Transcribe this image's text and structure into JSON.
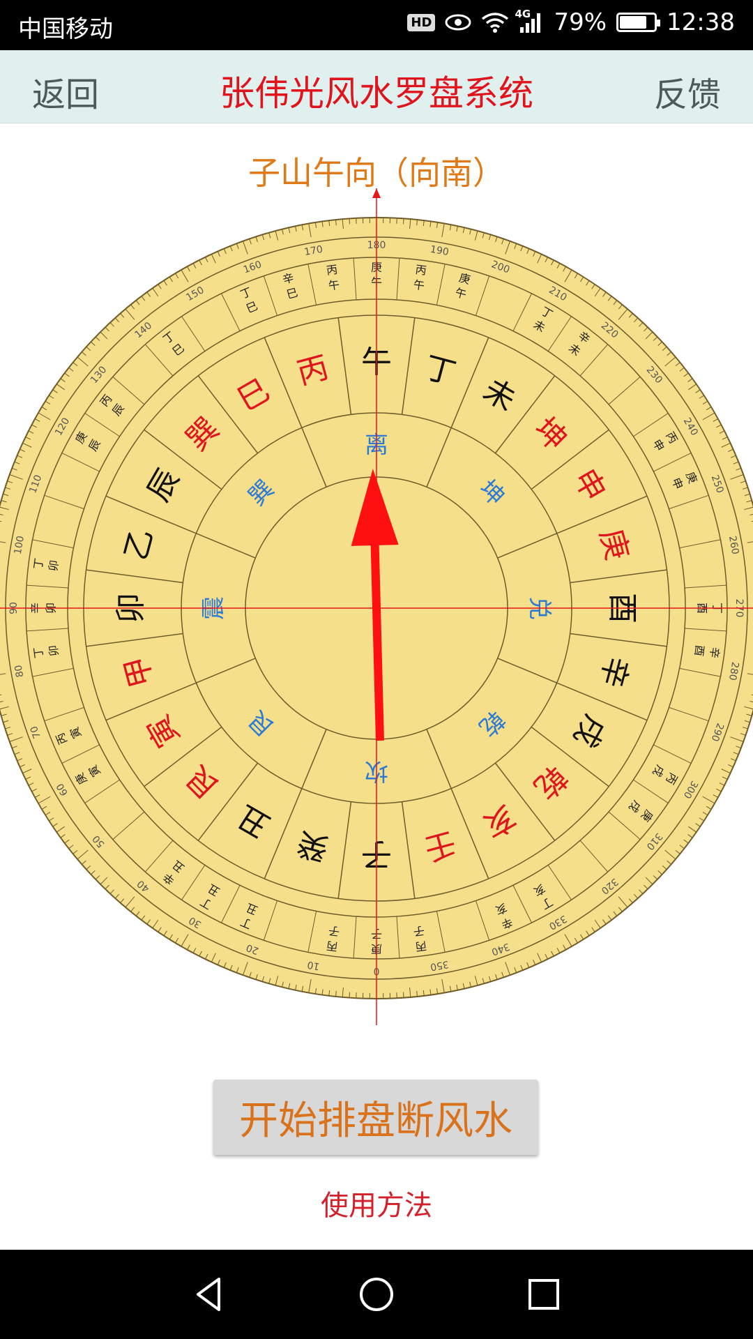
{
  "status_bar": {
    "carrier": "中国移动",
    "hd": "HD",
    "network": "4G",
    "battery": "79%",
    "battery_level": 0.79,
    "time": "12:38"
  },
  "header": {
    "back_label": "返回",
    "title": "张伟光风水罗盘系统",
    "feedback_label": "反馈"
  },
  "compass": {
    "direction": "子山午向（向南）",
    "needle_deg_ccw_from_north": 1.5,
    "colors": {
      "face": "#f6df8b",
      "line": "#6e5b2a",
      "crosshair": "#e8151b",
      "needle": "#ff1010",
      "red_text": "#e0141c",
      "blue_text": "#2b7bd6",
      "black_text": "#111111"
    },
    "trigram_ring": [
      {
        "text": "离",
        "angle": 180
      },
      {
        "text": "坤",
        "angle": 225
      },
      {
        "text": "兑",
        "angle": 270
      },
      {
        "text": "乾",
        "angle": 315
      },
      {
        "text": "坎",
        "angle": 0
      },
      {
        "text": "艮",
        "angle": 45
      },
      {
        "text": "震",
        "angle": 90
      },
      {
        "text": "巽",
        "angle": 135
      }
    ],
    "mountain_ring": [
      {
        "text": "午",
        "angle": 180,
        "color": "black"
      },
      {
        "text": "丁",
        "angle": 195,
        "color": "black"
      },
      {
        "text": "未",
        "angle": 210,
        "color": "black"
      },
      {
        "text": "坤",
        "angle": 225,
        "color": "red"
      },
      {
        "text": "申",
        "angle": 240,
        "color": "red"
      },
      {
        "text": "庚",
        "angle": 255,
        "color": "red"
      },
      {
        "text": "酉",
        "angle": 270,
        "color": "black"
      },
      {
        "text": "辛",
        "angle": 285,
        "color": "black"
      },
      {
        "text": "戌",
        "angle": 300,
        "color": "black"
      },
      {
        "text": "乾",
        "angle": 315,
        "color": "red"
      },
      {
        "text": "亥",
        "angle": 330,
        "color": "red"
      },
      {
        "text": "壬",
        "angle": 345,
        "color": "red"
      },
      {
        "text": "子",
        "angle": 0,
        "color": "black"
      },
      {
        "text": "癸",
        "angle": 15,
        "color": "black"
      },
      {
        "text": "丑",
        "angle": 30,
        "color": "black"
      },
      {
        "text": "艮",
        "angle": 45,
        "color": "red"
      },
      {
        "text": "寅",
        "angle": 60,
        "color": "red"
      },
      {
        "text": "甲",
        "angle": 75,
        "color": "red"
      },
      {
        "text": "卯",
        "angle": 90,
        "color": "black"
      },
      {
        "text": "乙",
        "angle": 105,
        "color": "black"
      },
      {
        "text": "辰",
        "angle": 120,
        "color": "black"
      },
      {
        "text": "巽",
        "angle": 135,
        "color": "red"
      },
      {
        "text": "巳",
        "angle": 150,
        "color": "red"
      },
      {
        "text": "丙",
        "angle": 165,
        "color": "red"
      }
    ],
    "outer_ring_cells": [
      {
        "angle": 180,
        "lines": [
          "庚",
          "午"
        ]
      },
      {
        "angle": 187.5,
        "lines": [
          "丙",
          "午"
        ]
      },
      {
        "angle": 172.5,
        "lines": [
          "丙",
          "午"
        ]
      },
      {
        "angle": 195,
        "lines": [
          "庚",
          "午"
        ]
      },
      {
        "angle": 165,
        "lines": [
          "辛",
          "巳"
        ]
      },
      {
        "angle": 210,
        "lines": [
          "丁",
          "未"
        ]
      },
      {
        "angle": 217.5,
        "lines": [
          "辛",
          "未"
        ]
      },
      {
        "angle": 157.5,
        "lines": [
          "丁",
          "巳"
        ]
      },
      {
        "angle": 240,
        "lines": [
          "丙",
          "申"
        ]
      },
      {
        "angle": 247.5,
        "lines": [
          "庚",
          "申"
        ]
      },
      {
        "angle": 142.5,
        "lines": [
          "丁",
          "巳"
        ]
      },
      {
        "angle": 270,
        "lines": [
          "丁",
          "酉"
        ]
      },
      {
        "angle": 277.5,
        "lines": [
          "辛",
          "酉"
        ]
      },
      {
        "angle": 90,
        "lines": [
          "辛",
          "卯"
        ]
      },
      {
        "angle": 97.5,
        "lines": [
          "丁",
          "卯"
        ]
      },
      {
        "angle": 82.5,
        "lines": [
          "丁",
          "卯"
        ]
      },
      {
        "angle": 300,
        "lines": [
          "丙",
          "戌"
        ]
      },
      {
        "angle": 307.5,
        "lines": [
          "庚",
          "戌"
        ]
      },
      {
        "angle": 120,
        "lines": [
          "庚",
          "辰"
        ]
      },
      {
        "angle": 127.5,
        "lines": [
          "丙",
          "辰"
        ]
      },
      {
        "angle": 330,
        "lines": [
          "丁",
          "亥"
        ]
      },
      {
        "angle": 337.5,
        "lines": [
          "辛",
          "亥"
        ]
      },
      {
        "angle": 60,
        "lines": [
          "庚",
          "寅"
        ]
      },
      {
        "angle": 67.5,
        "lines": [
          "丙",
          "寅"
        ]
      },
      {
        "angle": 0,
        "lines": [
          "庚",
          "子"
        ]
      },
      {
        "angle": 7.5,
        "lines": [
          "丙",
          "子"
        ]
      },
      {
        "angle": 352.5,
        "lines": [
          "丙",
          "子"
        ]
      },
      {
        "angle": 30,
        "lines": [
          "丁",
          "丑"
        ]
      },
      {
        "angle": 37.5,
        "lines": [
          "辛",
          "丑"
        ]
      },
      {
        "angle": 22.5,
        "lines": [
          "丁",
          "丑"
        ]
      }
    ],
    "degree_labels": [
      "0",
      "10",
      "20",
      "30",
      "40",
      "50",
      "60",
      "70",
      "80",
      "90",
      "100",
      "110",
      "120",
      "130",
      "140",
      "150",
      "160",
      "170",
      "180",
      "190",
      "200",
      "210",
      "220",
      "230",
      "240",
      "250",
      "260",
      "270",
      "280",
      "290",
      "300",
      "310",
      "320",
      "330",
      "340",
      "350"
    ]
  },
  "actions": {
    "start_label": "开始排盘断风水",
    "help_label": "使用方法"
  },
  "nav_icons": [
    "back-triangle-icon",
    "home-circle-icon",
    "recent-square-icon"
  ]
}
